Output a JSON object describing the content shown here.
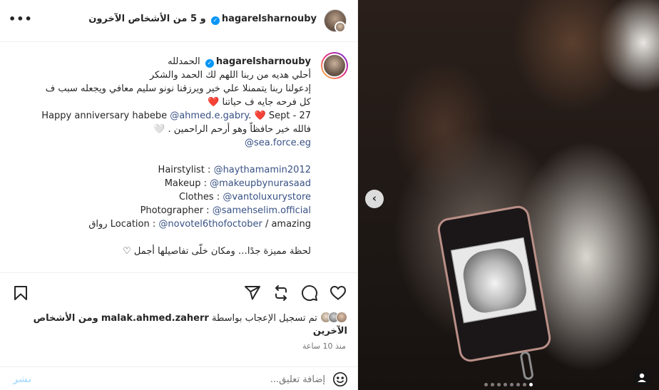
{
  "header": {
    "username": "hagarelsharnouby",
    "others_text": "و 5 من الأشخاص الآخرون",
    "more_label": "•••"
  },
  "caption": {
    "username": "hagarelsharnouby",
    "lines": [
      "الحمدلله",
      "أحلي هديه من ربنا اللهم لك الحمد والشكر",
      "إدعولنا ربنا يتممنلا علي خير ويرزقنا نونو سليم معافي ويجعله سبب ف",
      "كل فرحه جايه ف حياتنا"
    ],
    "heart": "❤️",
    "anniv_prefix": "27 - Sept",
    "anniv_text": "Happy anniversary habebe",
    "anniv_mention": "@ahmed.e.gabry",
    "anniv_end": ".",
    "prayer": "فالله خير حافظاً وهو أرحم الراحمين . 🤍",
    "seaforce": "@sea.force.eg",
    "credits": [
      {
        "label": "Hairstylist :",
        "mention": "@haythamamin2012",
        "suffix": ""
      },
      {
        "label": "Makeup :",
        "mention": "@makeupbynurasaad",
        "suffix": ""
      },
      {
        "label": "Clothes :",
        "mention": "@vantoluxurystore",
        "suffix": ""
      },
      {
        "label": "Photographer :",
        "mention": "@samehselim.official",
        "suffix": ""
      },
      {
        "label": "Location :",
        "mention": "@novotel6thofoctober",
        "suffix": "/ amazing"
      }
    ],
    "location_ar": "رواق",
    "closing": "لحظة مميزة جدًا… ومكان خلّى تفاصيلها أجمل",
    "closing_icon": "♡"
  },
  "likes": {
    "prefix": "تم تسجيل الإعجاب بواسطة",
    "user": "malak.ahmed.zaherr",
    "suffix": "ومن الأشخاص الآخرين"
  },
  "time": "منذ 10 ساعة",
  "comment": {
    "placeholder": "إضافة تعليق...",
    "post_label": "نشر"
  },
  "photo": {
    "dots": 8,
    "active_dot": 7
  }
}
